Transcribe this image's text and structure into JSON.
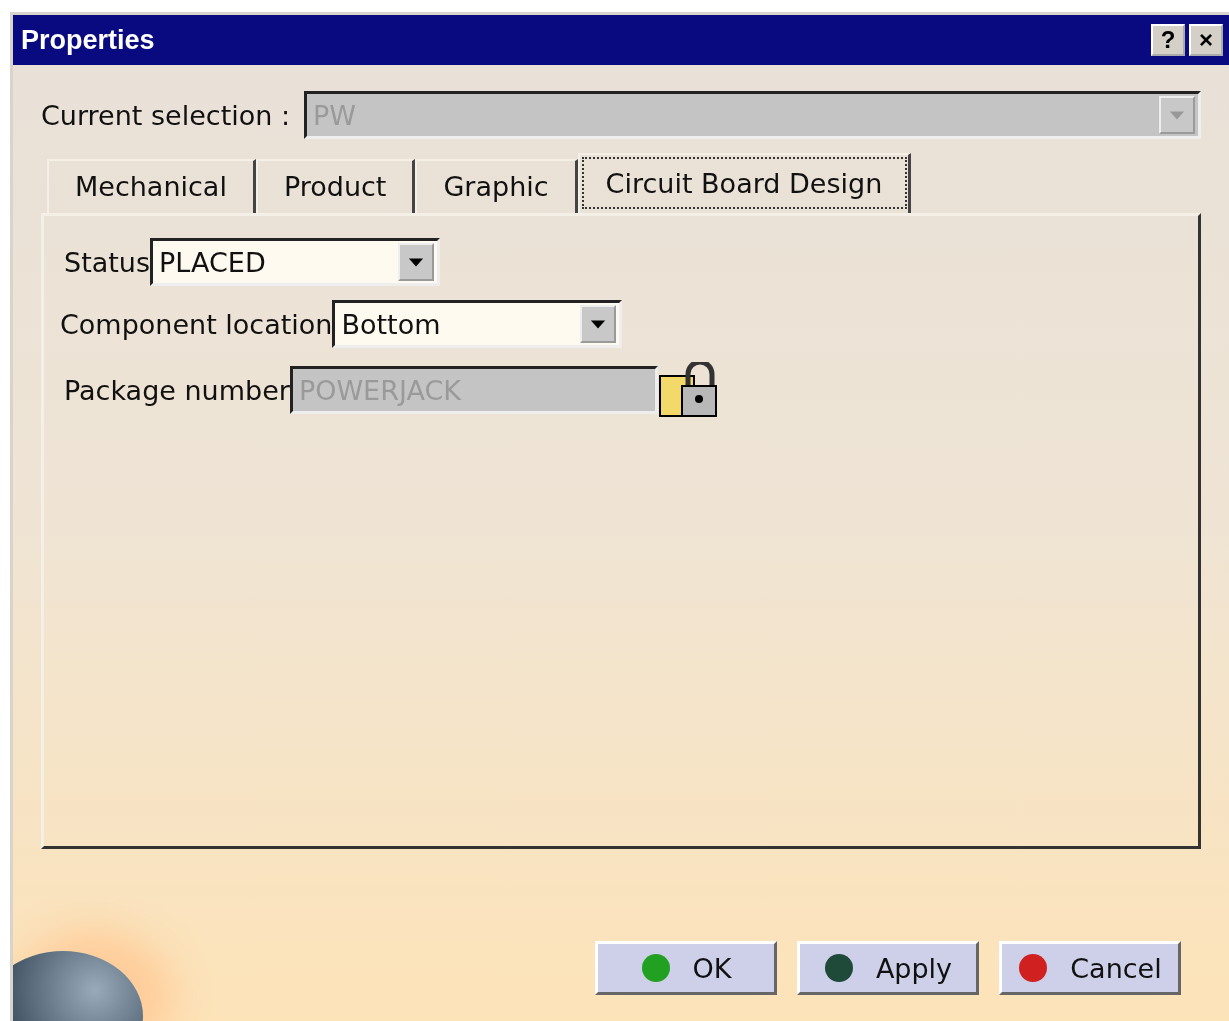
{
  "window": {
    "title": "Properties",
    "title_buttons": [
      "?",
      "×"
    ]
  },
  "current_selection": {
    "label": "Current selection :",
    "value": "PW",
    "disabled": true
  },
  "tabs": [
    {
      "label": "Mechanical",
      "selected": false
    },
    {
      "label": "Product",
      "selected": false
    },
    {
      "label": "Graphic",
      "selected": false
    },
    {
      "label": "Circuit Board Design",
      "selected": true
    }
  ],
  "fields": [
    {
      "kind": "dropdown",
      "label": "Status",
      "value": "PLACED",
      "disabled": false
    },
    {
      "kind": "dropdown",
      "label": "Component location",
      "value": "Bottom",
      "disabled": false
    },
    {
      "kind": "locked",
      "label": "Package number",
      "value": "POWERJACK",
      "disabled": true
    }
  ],
  "buttons": [
    {
      "label": "OK",
      "color": "#22a022"
    },
    {
      "label": "Apply",
      "color": "#1f4a3a"
    },
    {
      "label": "Cancel",
      "color": "#d02020"
    }
  ]
}
